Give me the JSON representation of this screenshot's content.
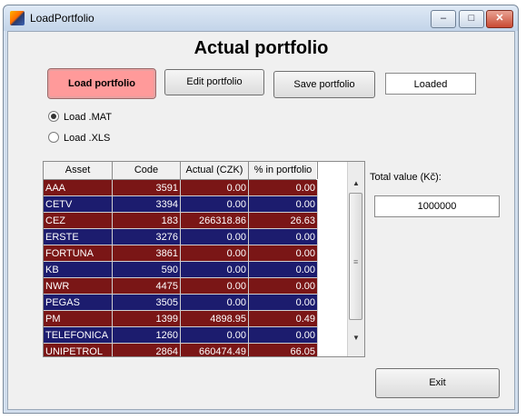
{
  "window": {
    "title": "LoadPortfolio",
    "controls": [
      "–",
      "□",
      "✕"
    ]
  },
  "heading": "Actual portfolio",
  "buttons": {
    "load": "Load portfolio",
    "edit": "Edit portfolio",
    "save": "Save portfolio",
    "exit": "Exit"
  },
  "status": "Loaded",
  "radios": [
    {
      "label": "Load .MAT",
      "selected": true
    },
    {
      "label": "Load .XLS",
      "selected": false
    }
  ],
  "table": {
    "columns": [
      "Asset",
      "Code",
      "Actual (CZK)",
      "% in portfolio"
    ],
    "rows": [
      [
        "AAA",
        "3591",
        "0.00",
        "0.00"
      ],
      [
        "CETV",
        "3394",
        "0.00",
        "0.00"
      ],
      [
        "CEZ",
        "183",
        "266318.86",
        "26.63"
      ],
      [
        "ERSTE",
        "3276",
        "0.00",
        "0.00"
      ],
      [
        "FORTUNA",
        "3861",
        "0.00",
        "0.00"
      ],
      [
        "KB",
        "590",
        "0.00",
        "0.00"
      ],
      [
        "NWR",
        "4475",
        "0.00",
        "0.00"
      ],
      [
        "PEGAS",
        "3505",
        "0.00",
        "0.00"
      ],
      [
        "PM",
        "1399",
        "4898.95",
        "0.49"
      ],
      [
        "TELEFONICA",
        "1260",
        "0.00",
        "0.00"
      ],
      [
        "UNIPETROL",
        "2864",
        "660474.49",
        "66.05"
      ]
    ]
  },
  "total": {
    "label": "Total value (Kč):",
    "value": "1000000"
  }
}
